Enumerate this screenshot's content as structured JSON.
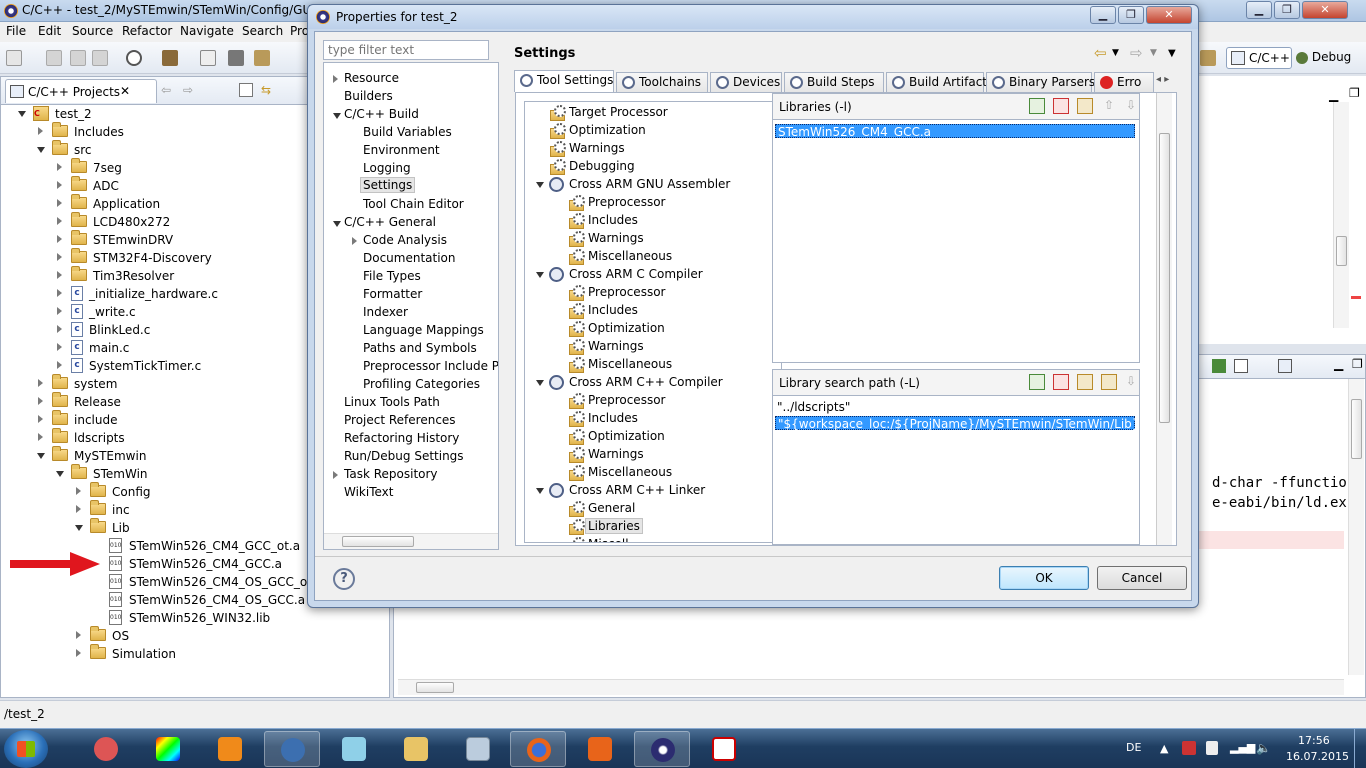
{
  "window": {
    "title": "C/C++ - test_2/MySTEmwin/STemWin/Config/GUIConf.c - Eclipse",
    "title_visible": "C/C++ - test_2/MySTEmwin/STemWin/Config/GUICo"
  },
  "menu": [
    "File",
    "Edit",
    "Source",
    "Refactor",
    "Navigate",
    "Search",
    "Pro"
  ],
  "perspectives": {
    "cpp": "C/C++",
    "debug": "Debug"
  },
  "project_panel": {
    "tab": "C/C++ Projects",
    "tree": [
      {
        "label": "test_2",
        "depth": 0,
        "kind": "project",
        "state": "open"
      },
      {
        "label": "Includes",
        "depth": 1,
        "kind": "folder",
        "state": "closed"
      },
      {
        "label": "src",
        "depth": 1,
        "kind": "folder",
        "state": "open"
      },
      {
        "label": "7seg",
        "depth": 2,
        "kind": "folder",
        "state": "closed"
      },
      {
        "label": "ADC",
        "depth": 2,
        "kind": "folder",
        "state": "closed"
      },
      {
        "label": "Application",
        "depth": 2,
        "kind": "folder",
        "state": "closed"
      },
      {
        "label": "LCD480x272",
        "depth": 2,
        "kind": "folder",
        "state": "closed"
      },
      {
        "label": "STEmwinDRV",
        "depth": 2,
        "kind": "folder",
        "state": "closed"
      },
      {
        "label": "STM32F4-Discovery",
        "depth": 2,
        "kind": "folder",
        "state": "closed"
      },
      {
        "label": "Tim3Resolver",
        "depth": 2,
        "kind": "folder",
        "state": "closed"
      },
      {
        "label": "_initialize_hardware.c",
        "depth": 2,
        "kind": "cfile",
        "state": "closed"
      },
      {
        "label": "_write.c",
        "depth": 2,
        "kind": "cfile",
        "state": "closed"
      },
      {
        "label": "BlinkLed.c",
        "depth": 2,
        "kind": "cfile",
        "state": "closed"
      },
      {
        "label": "main.c",
        "depth": 2,
        "kind": "cfile",
        "state": "closed"
      },
      {
        "label": "SystemTickTimer.c",
        "depth": 2,
        "kind": "cfile",
        "state": "closed"
      },
      {
        "label": "system",
        "depth": 1,
        "kind": "folder",
        "state": "closed"
      },
      {
        "label": "Release",
        "depth": 1,
        "kind": "folder",
        "state": "closed"
      },
      {
        "label": "include",
        "depth": 1,
        "kind": "folder",
        "state": "closed"
      },
      {
        "label": "ldscripts",
        "depth": 1,
        "kind": "folder",
        "state": "closed"
      },
      {
        "label": "MySTEmwin",
        "depth": 1,
        "kind": "folder",
        "state": "open"
      },
      {
        "label": "STemWin",
        "depth": 2,
        "kind": "folder",
        "state": "open"
      },
      {
        "label": "Config",
        "depth": 3,
        "kind": "folder",
        "state": "closed"
      },
      {
        "label": "inc",
        "depth": 3,
        "kind": "folder",
        "state": "closed"
      },
      {
        "label": "Lib",
        "depth": 3,
        "kind": "folder",
        "state": "open"
      },
      {
        "label": "STemWin526_CM4_GCC_ot.a",
        "depth": 4,
        "kind": "lib",
        "state": "none"
      },
      {
        "label": "STemWin526_CM4_GCC.a",
        "depth": 4,
        "kind": "lib",
        "state": "none"
      },
      {
        "label": "STemWin526_CM4_OS_GCC_ot.a",
        "depth": 4,
        "kind": "lib",
        "state": "none"
      },
      {
        "label": "STemWin526_CM4_OS_GCC.a",
        "depth": 4,
        "kind": "lib",
        "state": "none"
      },
      {
        "label": "STemWin526_WIN32.lib",
        "depth": 4,
        "kind": "lib",
        "state": "none"
      },
      {
        "label": "OS",
        "depth": 3,
        "kind": "folder",
        "state": "closed"
      },
      {
        "label": "Simulation",
        "depth": 3,
        "kind": "folder",
        "state": "closed"
      }
    ]
  },
  "console": {
    "lines": [
      "d-char -ffunctio",
      "e-eabi/bin/ld.ex"
    ]
  },
  "statusbar": {
    "path": "/test_2"
  },
  "taskbar": {
    "lang": "DE",
    "time": "17:56",
    "date": "16.07.2015"
  },
  "dialog": {
    "title": "Properties for test_2",
    "filter_placeholder": "type filter text",
    "nav": [
      {
        "label": "Resource",
        "depth": 0,
        "state": "closed"
      },
      {
        "label": "Builders",
        "depth": 0,
        "state": "none"
      },
      {
        "label": "C/C++ Build",
        "depth": 0,
        "state": "open"
      },
      {
        "label": "Build Variables",
        "depth": 1,
        "state": "none"
      },
      {
        "label": "Environment",
        "depth": 1,
        "state": "none"
      },
      {
        "label": "Logging",
        "depth": 1,
        "state": "none"
      },
      {
        "label": "Settings",
        "depth": 1,
        "state": "selected"
      },
      {
        "label": "Tool Chain Editor",
        "depth": 1,
        "state": "none"
      },
      {
        "label": "C/C++ General",
        "depth": 0,
        "state": "open"
      },
      {
        "label": "Code Analysis",
        "depth": 1,
        "state": "closed"
      },
      {
        "label": "Documentation",
        "depth": 1,
        "state": "none"
      },
      {
        "label": "File Types",
        "depth": 1,
        "state": "none"
      },
      {
        "label": "Formatter",
        "depth": 1,
        "state": "none"
      },
      {
        "label": "Indexer",
        "depth": 1,
        "state": "none"
      },
      {
        "label": "Language Mappings",
        "depth": 1,
        "state": "none"
      },
      {
        "label": "Paths and Symbols",
        "depth": 1,
        "state": "none"
      },
      {
        "label": "Preprocessor Include Pa",
        "depth": 1,
        "state": "none"
      },
      {
        "label": "Profiling Categories",
        "depth": 1,
        "state": "none"
      },
      {
        "label": "Linux Tools Path",
        "depth": 0,
        "state": "none"
      },
      {
        "label": "Project References",
        "depth": 0,
        "state": "none"
      },
      {
        "label": "Refactoring History",
        "depth": 0,
        "state": "none"
      },
      {
        "label": "Run/Debug Settings",
        "depth": 0,
        "state": "none"
      },
      {
        "label": "Task Repository",
        "depth": 0,
        "state": "closed"
      },
      {
        "label": "WikiText",
        "depth": 0,
        "state": "none"
      }
    ],
    "heading": "Settings",
    "tabs": [
      {
        "label": "Tool Settings",
        "active": true
      },
      {
        "label": "Toolchains",
        "active": false
      },
      {
        "label": "Devices",
        "active": false
      },
      {
        "label": "Build Steps",
        "active": false
      },
      {
        "label": "Build Artifact",
        "active": false
      },
      {
        "label": "Binary Parsers",
        "active": false
      },
      {
        "label": "Erro",
        "active": false
      }
    ],
    "tool_tree": [
      {
        "label": "Target Processor",
        "depth": 0,
        "kind": "gear",
        "state": "none"
      },
      {
        "label": "Optimization",
        "depth": 0,
        "kind": "gear",
        "state": "none"
      },
      {
        "label": "Warnings",
        "depth": 0,
        "kind": "gear",
        "state": "none"
      },
      {
        "label": "Debugging",
        "depth": 0,
        "kind": "gear",
        "state": "none"
      },
      {
        "label": "Cross ARM GNU Assembler",
        "depth": 0,
        "kind": "tool",
        "state": "open"
      },
      {
        "label": "Preprocessor",
        "depth": 1,
        "kind": "gear",
        "state": "none"
      },
      {
        "label": "Includes",
        "depth": 1,
        "kind": "gear",
        "state": "none"
      },
      {
        "label": "Warnings",
        "depth": 1,
        "kind": "gear",
        "state": "none"
      },
      {
        "label": "Miscellaneous",
        "depth": 1,
        "kind": "gear",
        "state": "none"
      },
      {
        "label": "Cross ARM C Compiler",
        "depth": 0,
        "kind": "tool",
        "state": "open"
      },
      {
        "label": "Preprocessor",
        "depth": 1,
        "kind": "gear",
        "state": "none"
      },
      {
        "label": "Includes",
        "depth": 1,
        "kind": "gear",
        "state": "none"
      },
      {
        "label": "Optimization",
        "depth": 1,
        "kind": "gear",
        "state": "none"
      },
      {
        "label": "Warnings",
        "depth": 1,
        "kind": "gear",
        "state": "none"
      },
      {
        "label": "Miscellaneous",
        "depth": 1,
        "kind": "gear",
        "state": "none"
      },
      {
        "label": "Cross ARM C++ Compiler",
        "depth": 0,
        "kind": "tool",
        "state": "open"
      },
      {
        "label": "Preprocessor",
        "depth": 1,
        "kind": "gear",
        "state": "none"
      },
      {
        "label": "Includes",
        "depth": 1,
        "kind": "gear",
        "state": "none"
      },
      {
        "label": "Optimization",
        "depth": 1,
        "kind": "gear",
        "state": "none"
      },
      {
        "label": "Warnings",
        "depth": 1,
        "kind": "gear",
        "state": "none"
      },
      {
        "label": "Miscellaneous",
        "depth": 1,
        "kind": "gear",
        "state": "none"
      },
      {
        "label": "Cross ARM C++ Linker",
        "depth": 0,
        "kind": "tool",
        "state": "open"
      },
      {
        "label": "General",
        "depth": 1,
        "kind": "gear",
        "state": "none"
      },
      {
        "label": "Libraries",
        "depth": 1,
        "kind": "gear",
        "state": "selected"
      },
      {
        "label": "Miscell",
        "depth": 1,
        "kind": "gear",
        "state": "none"
      }
    ],
    "libraries": {
      "header": "Libraries (-l)",
      "items": [
        "STemWin526_CM4_GCC.a"
      ]
    },
    "search_path": {
      "header": "Library search path (-L)",
      "items": [
        "\"../ldscripts\"",
        "\"${workspace_loc:/${ProjName}/MySTEmwin/STemWin/Lib}\""
      ]
    },
    "ok": "OK",
    "cancel": "Cancel",
    "help": "?"
  }
}
